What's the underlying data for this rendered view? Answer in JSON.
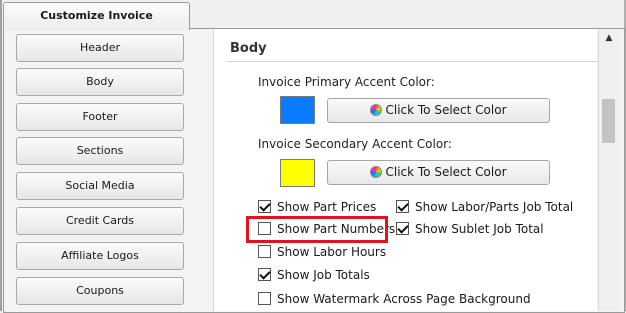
{
  "window": {
    "tab_title": "Customize Invoice"
  },
  "sidebar": {
    "items": [
      {
        "label": "Header"
      },
      {
        "label": "Body"
      },
      {
        "label": "Footer"
      },
      {
        "label": "Sections"
      },
      {
        "label": "Social Media"
      },
      {
        "label": "Credit Cards"
      },
      {
        "label": "Affiliate Logos"
      },
      {
        "label": "Coupons"
      }
    ]
  },
  "panel": {
    "section_title": "Body",
    "primary_color": {
      "label": "Invoice Primary Accent Color:",
      "swatch_color": "#0a7cff",
      "button_label": "Click To Select Color"
    },
    "secondary_color": {
      "label": "Invoice Secondary Accent Color:",
      "swatch_color": "#ffff00",
      "button_label": "Click To Select Color"
    },
    "options": [
      {
        "label": "Show Part Prices",
        "checked": true
      },
      {
        "label": "Show Labor/Parts Job Total",
        "checked": true
      },
      {
        "label": "Show Part Numbers",
        "checked": false
      },
      {
        "label": "Show Sublet Job Total",
        "checked": true
      },
      {
        "label": "Show Labor Hours",
        "checked": false
      },
      {
        "label": "Show Job Totals",
        "checked": true
      },
      {
        "label": "Show Watermark Across Page Background",
        "checked": false
      }
    ]
  },
  "colors": {
    "highlight_border": "#e0141e"
  },
  "icons": {
    "color_wheel": "color-wheel-icon",
    "scroll_up": "scroll-up-arrow-icon"
  }
}
